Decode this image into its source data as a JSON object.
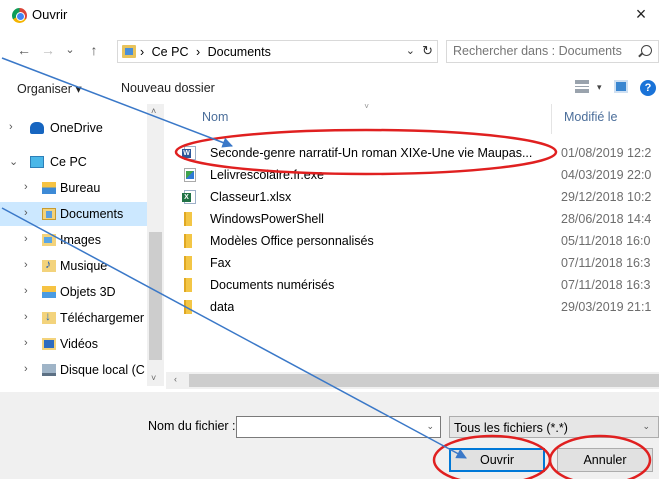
{
  "window": {
    "title": "Ouvrir",
    "close_glyph": "×"
  },
  "nav": {
    "back": "←",
    "forward": "→",
    "recent": "⌄",
    "up": "↑",
    "breadcrumbs": [
      "Ce PC",
      "Documents"
    ],
    "crumb_sep": "›",
    "address_dropdown": "⌄",
    "refresh": "↻",
    "search_placeholder": "Rechercher dans : Documents"
  },
  "toolbar": {
    "organize": "Organiser ▾",
    "new_folder": "Nouveau dossier",
    "view_dropdown": "▾",
    "help": "?"
  },
  "sidebar": {
    "items": [
      {
        "label": "OneDrive",
        "icon": "onedrive-icon",
        "chevron": "›"
      },
      {
        "label": "Ce PC",
        "icon": "computer-icon",
        "chevron": "⌄"
      },
      {
        "label": "Bureau",
        "icon": "desktop-folder-icon",
        "chevron": "›"
      },
      {
        "label": "Documents",
        "icon": "documents-folder-icon",
        "chevron": "›",
        "selected": true
      },
      {
        "label": "Images",
        "icon": "pictures-folder-icon",
        "chevron": "›"
      },
      {
        "label": "Musique",
        "icon": "music-folder-icon",
        "chevron": "›"
      },
      {
        "label": "Objets 3D",
        "icon": "3d-objects-folder-icon",
        "chevron": "›"
      },
      {
        "label": "Téléchargemer",
        "icon": "downloads-folder-icon",
        "chevron": "›"
      },
      {
        "label": "Vidéos",
        "icon": "videos-folder-icon",
        "chevron": "›"
      },
      {
        "label": "Disque local (C",
        "icon": "local-disk-icon",
        "chevron": "›"
      }
    ],
    "scroll_up": "˄",
    "scroll_down": "˅"
  },
  "file_list": {
    "columns": {
      "name": "Nom",
      "modified": "Modifié le"
    },
    "sort_indicator": "˅",
    "rows": [
      {
        "name": "Seconde-genre narratif-Un roman XIXe-Une vie Maupas...",
        "modified": "01/08/2019 12:2",
        "type": "word"
      },
      {
        "name": "Lelivrescolaire.fr.exe",
        "modified": "04/03/2019 22:0",
        "type": "exe"
      },
      {
        "name": "Classeur1.xlsx",
        "modified": "29/12/2018 10:2",
        "type": "xlsx"
      },
      {
        "name": "WindowsPowerShell",
        "modified": "28/06/2018 14:4",
        "type": "folder"
      },
      {
        "name": "Modèles Office personnalisés",
        "modified": "05/11/2018 16:0",
        "type": "folder"
      },
      {
        "name": "Fax",
        "modified": "07/11/2018 16:3",
        "type": "folder"
      },
      {
        "name": "Documents numérisés",
        "modified": "07/11/2018 16:3",
        "type": "folder"
      },
      {
        "name": "data",
        "modified": "29/03/2019 21:1",
        "type": "folder"
      }
    ],
    "hscroll_left": "‹"
  },
  "footer": {
    "filename_label": "Nom du fichier :",
    "filename_value": "",
    "filename_dropdown": "⌄",
    "filter_value": "Tous les fichiers (*.*)",
    "filter_dropdown": "⌄",
    "open_button": "Ouvrir",
    "cancel_button": "Annuler"
  },
  "colors": {
    "accent": "#0078d7",
    "selection": "#cce8ff",
    "annotation_red": "#e02020",
    "annotation_arrow": "#3a78c8"
  }
}
